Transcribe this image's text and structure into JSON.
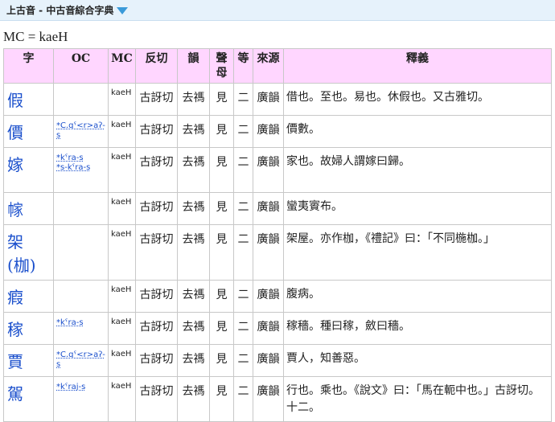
{
  "header": {
    "title": "上古音 - 中古音綜合字典"
  },
  "mc_line": "MC = kaeH",
  "columns": [
    "字",
    "OC",
    "MC",
    "反切",
    "韻",
    "聲母",
    "等",
    "來源",
    "釋義"
  ],
  "rows": [
    {
      "char": "假",
      "oc": [],
      "mc": "kaeH",
      "fanqie": "古訝切",
      "yun": "去禡",
      "initial": "見",
      "deng": "二",
      "source": "廣韻",
      "def": "借也。至也。易也。休假也。又古雅切。"
    },
    {
      "char": "價",
      "oc": [
        "*C.qˤ<r>aʔ-s"
      ],
      "mc": "kaeH",
      "fanqie": "古訝切",
      "yun": "去禡",
      "initial": "見",
      "deng": "二",
      "source": "廣韻",
      "def": "價數。"
    },
    {
      "char": "嫁",
      "oc": [
        "*kˤra-s",
        "*s-kˤra-s"
      ],
      "mc": "kaeH",
      "fanqie": "古訝切",
      "yun": "去禡",
      "initial": "見",
      "deng": "二",
      "source": "廣韻",
      "def": "家也。故婦人謂嫁曰歸。"
    },
    {
      "char": "幏",
      "oc": [],
      "mc": "kaeH",
      "fanqie": "古訝切",
      "yun": "去禡",
      "initial": "見",
      "deng": "二",
      "source": "廣韻",
      "def": "蠻夷賨布。"
    },
    {
      "char": "架(枷)",
      "oc": [],
      "mc": "kaeH",
      "fanqie": "古訝切",
      "yun": "去禡",
      "initial": "見",
      "deng": "二",
      "source": "廣韻",
      "def": "架屋。亦作枷，《禮記》曰：「不同椸枷。」"
    },
    {
      "char": "瘕",
      "oc": [],
      "mc": "kaeH",
      "fanqie": "古訝切",
      "yun": "去禡",
      "initial": "見",
      "deng": "二",
      "source": "廣韻",
      "def": "腹病。"
    },
    {
      "char": "稼",
      "oc": [
        "*kˤra-s"
      ],
      "mc": "kaeH",
      "fanqie": "古訝切",
      "yun": "去禡",
      "initial": "見",
      "deng": "二",
      "source": "廣韻",
      "def": "稼穡。種曰稼，斂曰穡。"
    },
    {
      "char": "賈",
      "oc": [
        "*C.qˤ<r>aʔ-s"
      ],
      "mc": "kaeH",
      "fanqie": "古訝切",
      "yun": "去禡",
      "initial": "見",
      "deng": "二",
      "source": "廣韻",
      "def": "賈人，知善惡。"
    },
    {
      "char": "駕",
      "oc": [
        "*kˤraj-s"
      ],
      "mc": "kaeH",
      "fanqie": "古訝切",
      "yun": "去禡",
      "initial": "見",
      "deng": "二",
      "source": "廣韻",
      "def": "行也。乘也。《說文》曰：「馬在軛中也。」古訝切。十二。"
    }
  ]
}
